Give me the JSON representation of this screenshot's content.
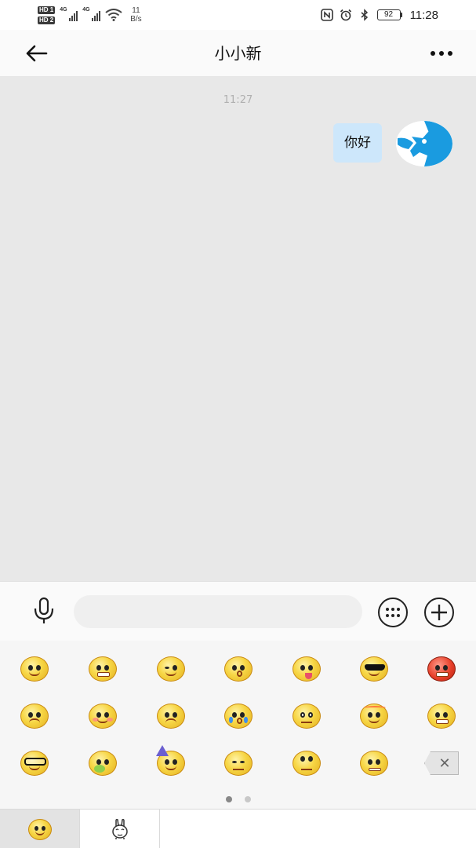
{
  "status_bar": {
    "hd1": "HD 1",
    "hd2": "HD 2",
    "net1": "4G",
    "net2": "4G",
    "speed_value": "11",
    "speed_unit": "B/s",
    "battery": "92",
    "time": "11:28"
  },
  "header": {
    "title": "小小新",
    "back_icon": "arrow-left-icon",
    "more_icon": "more-dots-icon"
  },
  "chat": {
    "timestamp": "11:27",
    "messages": [
      {
        "text": "你好",
        "from": "self"
      }
    ],
    "bubble_color": "#cde7fb",
    "background": "#e8e8e8"
  },
  "input_bar": {
    "voice_icon": "microphone-icon",
    "placeholder": "",
    "emoji_toggle_icon": "dots-grid-icon",
    "plus_icon": "plus-circle-icon"
  },
  "emoji_panel": {
    "emojis": [
      "smile",
      "grin",
      "smirk",
      "surprised",
      "tongue",
      "cool-shades",
      "angry",
      "confused",
      "blush",
      "sad",
      "crying",
      "stare",
      "headband",
      "grimace",
      "nerd-glasses",
      "sick",
      "party-hat",
      "meh",
      "roll-eyes",
      "zipped",
      "backspace"
    ],
    "page_count": 2,
    "active_page": 0,
    "tabs": [
      "emoji-smile-tab",
      "sticker-tab"
    ]
  }
}
